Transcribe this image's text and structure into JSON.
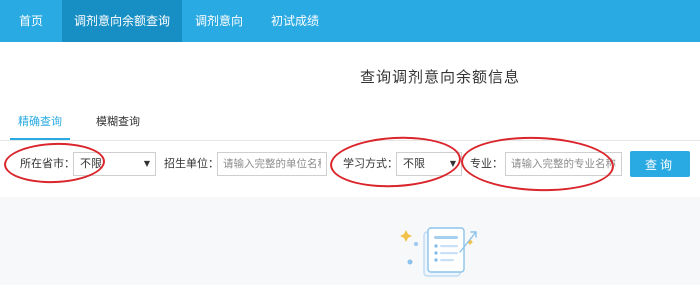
{
  "nav": {
    "items": [
      {
        "label": "首页"
      },
      {
        "label": "调剂意向余额查询"
      },
      {
        "label": "调剂意向"
      },
      {
        "label": "初试成绩"
      }
    ],
    "active_index": 1
  },
  "heading": "查询调剂意向余额信息",
  "subtabs": {
    "items": [
      {
        "label": "精确查询"
      },
      {
        "label": "模糊查询"
      }
    ],
    "active_index": 0
  },
  "filters": {
    "province": {
      "label": "所在省市：",
      "value": "不限"
    },
    "unit": {
      "label": "招生单位：",
      "placeholder": "请输入完整的单位名称"
    },
    "study_mode": {
      "label": "学习方式：",
      "value": "不限"
    },
    "major": {
      "label": "专业：",
      "placeholder": "请输入完整的专业名称"
    }
  },
  "query_button": "查询",
  "empty_state_icon": "empty-document-icon",
  "colors": {
    "accent": "#2aaae3",
    "nav_active": "#178fc5",
    "annotation": "#d9252b"
  }
}
